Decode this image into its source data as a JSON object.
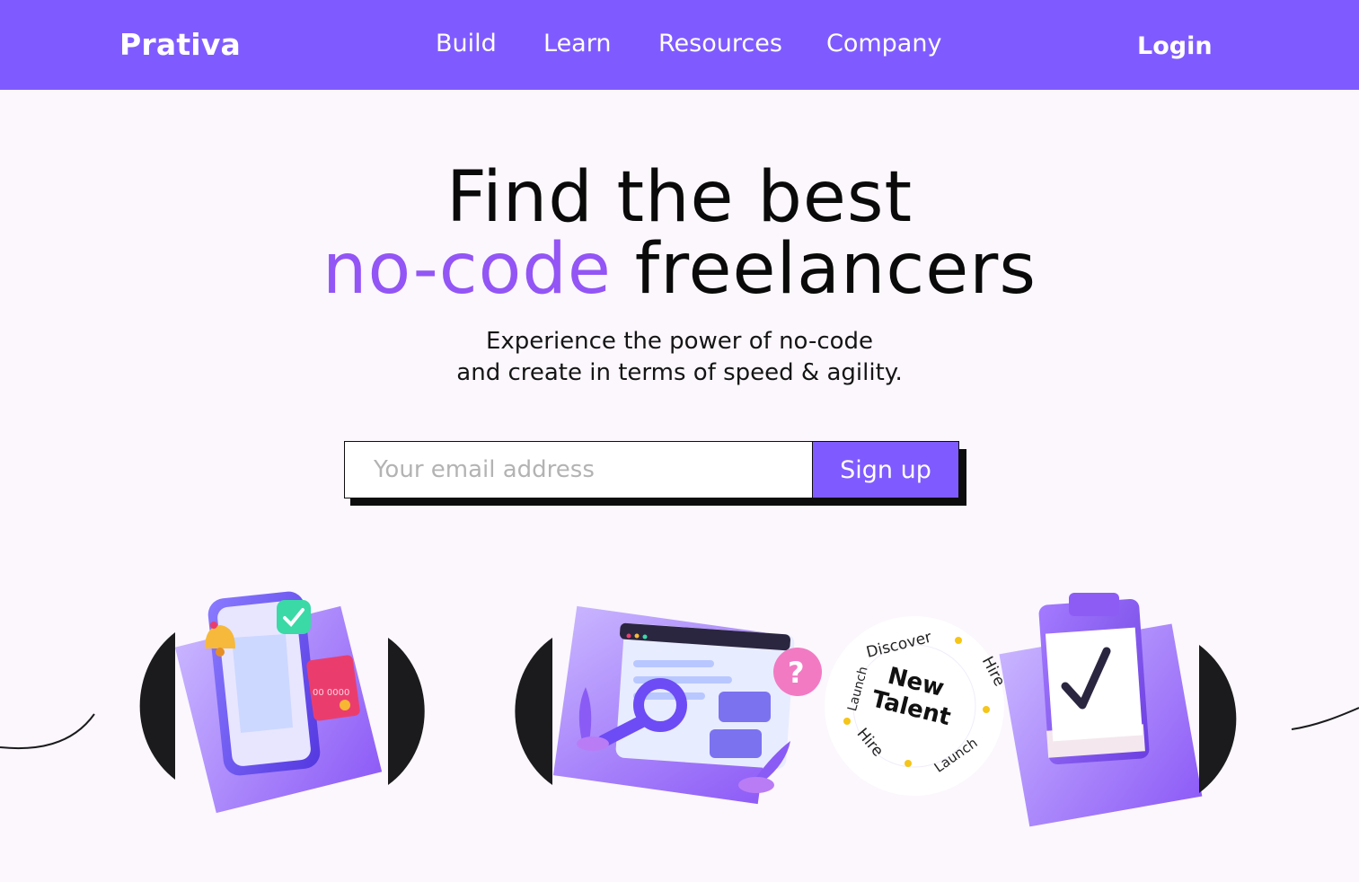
{
  "nav": {
    "brand": "Prativa",
    "links": [
      "Build",
      "Learn",
      "Resources",
      "Company"
    ],
    "login": "Login"
  },
  "hero": {
    "title_line1": "Find the best",
    "title_accent": "no-code",
    "title_rest": "freelancers",
    "subtitle_line1": "Experience the power of no-code",
    "subtitle_line2": "and create in terms of speed & agility."
  },
  "signup": {
    "placeholder": "Your email address",
    "button_label": "Sign up"
  },
  "badge": {
    "center_line1": "New",
    "center_line2": "Talent",
    "ring_words": [
      "Discover",
      "Hire",
      "Launch",
      "Hire",
      "Launch"
    ]
  },
  "card_illustration": {
    "card_number": "00 0000"
  },
  "colors": {
    "primary": "#7f5bff",
    "accent_text": "#9355f5",
    "background": "#fbf7fd",
    "dark": "#1b1b1d",
    "ring_dot": "#f5c518"
  },
  "icons": [
    "bell-icon",
    "check-icon",
    "credit-card-icon",
    "search-icon",
    "question-icon",
    "checkmark-icon"
  ]
}
